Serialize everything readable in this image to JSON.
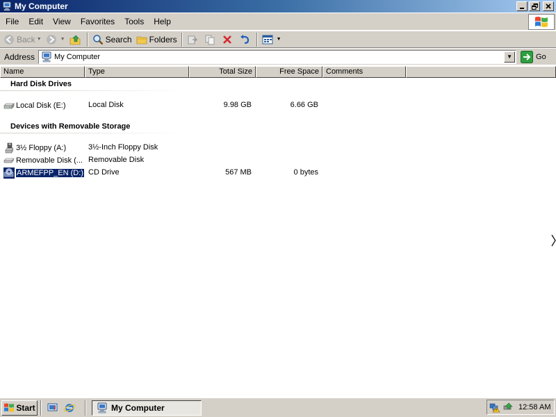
{
  "window": {
    "title": "My Computer",
    "icons": {
      "app": "my-computer-icon",
      "minimize": "minimize-icon",
      "maximize": "restore-icon",
      "close": "close-icon"
    }
  },
  "menubar": {
    "items": [
      "File",
      "Edit",
      "View",
      "Favorites",
      "Tools",
      "Help"
    ]
  },
  "toolbar": {
    "back_label": "Back",
    "search_label": "Search",
    "folders_label": "Folders"
  },
  "address": {
    "label": "Address",
    "value": "My Computer",
    "go_label": "Go"
  },
  "columns": {
    "name": "Name",
    "type": "Type",
    "total_size": "Total Size",
    "free_space": "Free Space",
    "comments": "Comments"
  },
  "groups": [
    {
      "title": "Hard Disk Drives",
      "items": [
        {
          "name": "Local Disk (E:)",
          "type": "Local Disk",
          "total": "9.98 GB",
          "free": "6.66 GB",
          "icon": "hard-disk-icon",
          "selected": false
        }
      ]
    },
    {
      "title": "Devices with Removable Storage",
      "items": [
        {
          "name": "3½ Floppy (A:)",
          "type": "3½-Inch Floppy Disk",
          "total": "",
          "free": "",
          "icon": "floppy-drive-icon",
          "selected": false
        },
        {
          "name": "Removable Disk (...",
          "type": "Removable Disk",
          "total": "",
          "free": "",
          "icon": "removable-disk-icon",
          "selected": false
        },
        {
          "name": "ARMEFPP_EN (D:)",
          "type": "CD Drive",
          "total": "567 MB",
          "free": "0 bytes",
          "icon": "cd-drive-icon",
          "selected": true
        }
      ]
    }
  ],
  "taskbar": {
    "start_label": "Start",
    "task_label": "My Computer",
    "clock": "12:58 AM"
  },
  "colors": {
    "titlebar_start": "#0a246a",
    "titlebar_end": "#a6caf0",
    "chrome": "#d4d0c8",
    "selection": "#0a246a"
  }
}
